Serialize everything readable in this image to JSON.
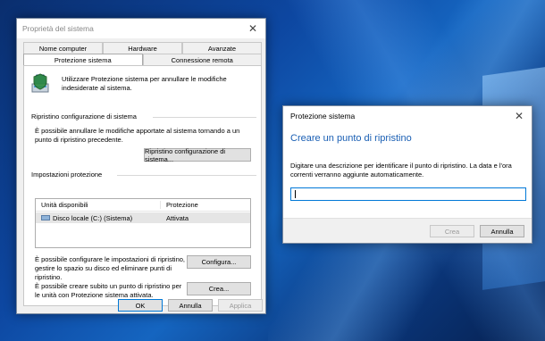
{
  "system_properties": {
    "title": "Proprietà del sistema",
    "tabs_row1": [
      "Nome computer",
      "Hardware",
      "Avanzate"
    ],
    "tabs_row2": [
      "Protezione sistema",
      "Connessione remota"
    ],
    "active_tab": "Protezione sistema",
    "intro": "Utilizzare Protezione sistema per annullare le modifiche indesiderate al sistema.",
    "restore_group": {
      "label": "Ripristino configurazione di sistema",
      "text": "È possibile annullare le modifiche apportate al sistema tornando a un punto di ripristino precedente.",
      "button": "Ripristino configurazione di sistema..."
    },
    "protection_group": {
      "label": "Impostazioni protezione",
      "columns": [
        "Unità disponibili",
        "Protezione"
      ],
      "rows": [
        {
          "drive": "Disco locale (C:) (Sistema)",
          "status": "Attivata"
        }
      ],
      "configure_text": "È possibile configurare le impostazioni di ripristino, gestire lo spazio su disco ed eliminare punti di ripristino.",
      "configure_button": "Configura...",
      "create_text": "È possibile creare subito un punto di ripristino per le unità con Protezione sistema attivata.",
      "create_button": "Crea..."
    },
    "ok_button": "OK",
    "cancel_button": "Annulla",
    "apply_button": "Applica"
  },
  "protection_dialog": {
    "title": "Protezione sistema",
    "heading": "Creare un punto di ripristino",
    "description": "Digitare una descrizione per identificare il punto di ripristino. La data e l'ora correnti verranno aggiunte automaticamente.",
    "input_value": "",
    "create_button": "Crea",
    "cancel_button": "Annulla"
  },
  "colors": {
    "accent": "#0078d7",
    "heading": "#1a5fb4",
    "dialog_bg": "#f0f0f0"
  }
}
